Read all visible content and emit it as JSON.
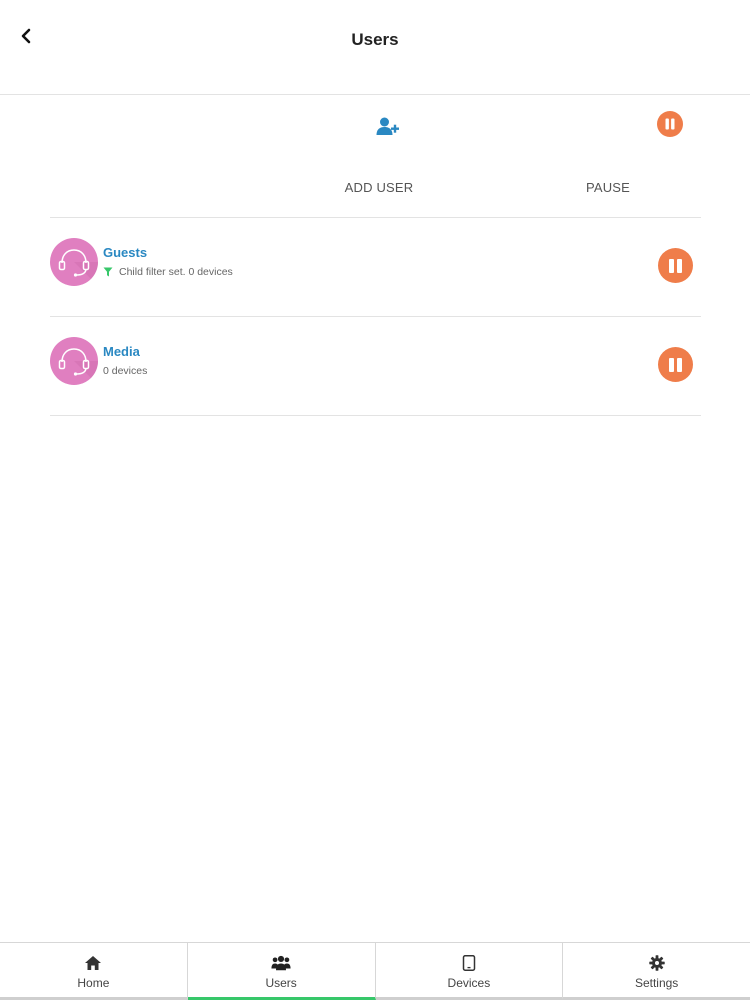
{
  "header": {
    "title": "Users",
    "back_icon": "chevron-left-icon"
  },
  "actions": {
    "add_user": {
      "label": "ADD USER",
      "icon": "add-user-icon",
      "color": "#2a88c2"
    },
    "pause": {
      "label": "PAUSE",
      "icon": "pause-icon",
      "color": "#ef7d4a"
    }
  },
  "users": [
    {
      "name": "Guests",
      "subtitle": "Child filter set. 0 devices",
      "has_filter": true,
      "avatar_icon": "headset-icon"
    },
    {
      "name": "Media",
      "subtitle": "0 devices",
      "has_filter": false,
      "avatar_icon": "headset-icon"
    }
  ],
  "tabs": [
    {
      "label": "Home",
      "icon": "home-icon",
      "active": false
    },
    {
      "label": "Users",
      "icon": "users-icon",
      "active": true
    },
    {
      "label": "Devices",
      "icon": "tablet-icon",
      "active": false
    },
    {
      "label": "Settings",
      "icon": "gear-icon",
      "active": false
    }
  ],
  "colors": {
    "accent_blue": "#2a88c2",
    "pause_orange": "#ef7d4a",
    "avatar_pink": "#e07fc0",
    "filter_green": "#37c76a",
    "active_tab": "#37c76a"
  }
}
